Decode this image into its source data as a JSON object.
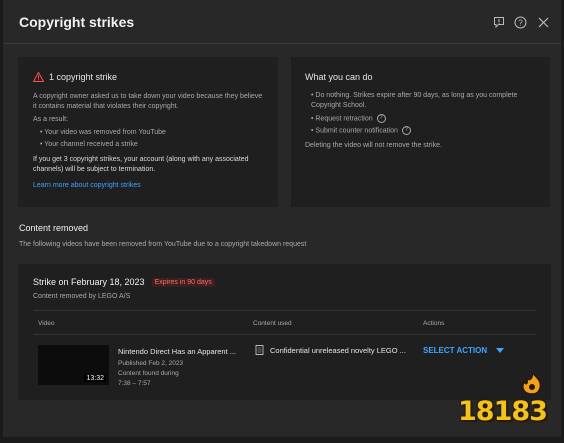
{
  "dialog": {
    "title": "Copyright strikes"
  },
  "strike_summary": {
    "heading": "1 copyright strike",
    "description": "A copyright owner asked us to take down your video because they believe it contains material that violates their copyright.",
    "as_result_label": "As a result:",
    "results": [
      "Your video was removed from YouTube",
      "Your channel received a strike"
    ],
    "warning": "If you get 3 copyright strikes, your account (along with any associated channels) will be subject to termination.",
    "learn_more": "Learn more about copyright strikes"
  },
  "what_you_can_do": {
    "heading": "What you can do",
    "options": [
      "Do nothing. Strikes expire after 90 days, as long as you complete Copyright School.",
      "Request retraction",
      "Submit counter notification"
    ],
    "note": "Deleting the video will not remove the strike."
  },
  "content_removed": {
    "title": "Content removed",
    "subtitle": "The following videos have been removed from YouTube due to a copyright takedown request"
  },
  "strike": {
    "date_label": "Strike on February 18, 2023",
    "expires": "Expires in 90 days",
    "removed_by": "Content removed by LEGO A/S",
    "columns": {
      "video": "Video",
      "content_used": "Content used",
      "actions": "Actions"
    },
    "video": {
      "title": "Nintendo Direct Has an Apparent ...",
      "published": "Published Feb 2, 2023",
      "content_found": "Content found during",
      "time_range": "7:38 – 7:57",
      "duration": "13:32"
    },
    "content_used": "Confidential unreleased novelty LEGO ...",
    "action_label": "SELECT ACTION"
  },
  "watermark": {
    "text": "18183"
  },
  "colors": {
    "link": "#3ea6ff",
    "warning_red": "#ff6b6b",
    "watermark": "#f2c21d"
  }
}
